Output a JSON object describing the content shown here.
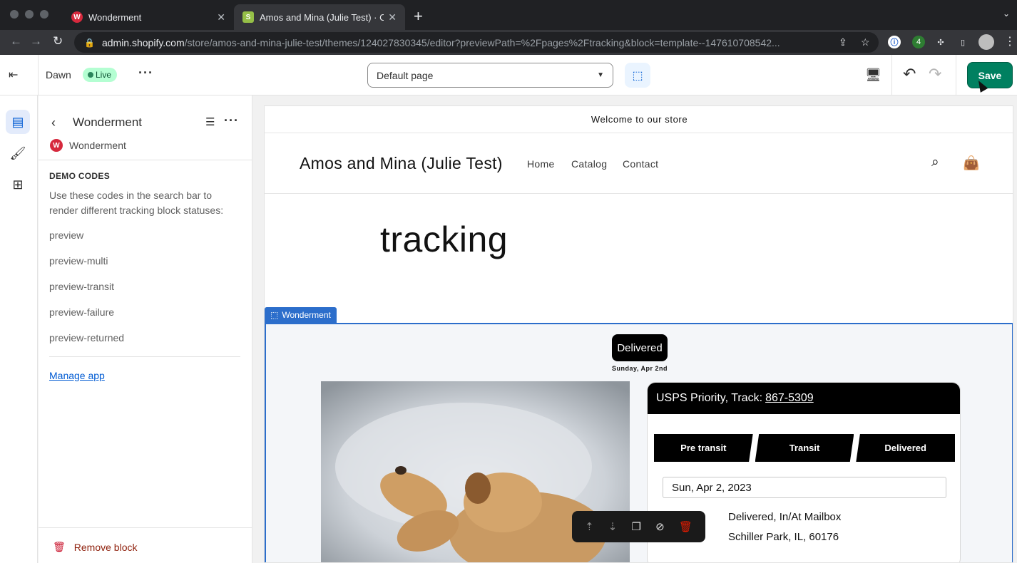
{
  "browser": {
    "tabs": [
      {
        "title": "Wonderment",
        "favicon": "W"
      },
      {
        "title": "Amos and Mina (Julie Test) · Customize",
        "favicon": "S"
      }
    ],
    "url_host": "admin.shopify.com",
    "url_path": "/store/amos-and-mina-julie-test/themes/124027830345/editor?previewPath=%2Fpages%2Ftracking&block=template--147610708542..."
  },
  "topbar": {
    "theme_name": "Dawn",
    "live_label": "Live",
    "page_select": "Default page",
    "save_label": "Save"
  },
  "sidebar": {
    "title": "Wonderment",
    "app_name": "Wonderment",
    "heading": "DEMO CODES",
    "description": "Use these codes in the search bar to render different tracking block statuses:",
    "codes": [
      "preview",
      "preview-multi",
      "preview-transit",
      "preview-failure",
      "preview-returned"
    ],
    "manage_link": "Manage app",
    "remove_label": "Remove block"
  },
  "store": {
    "announcement": "Welcome to our store",
    "name": "Amos and Mina (Julie Test)",
    "nav": [
      "Home",
      "Catalog",
      "Contact"
    ],
    "page_title": "tracking"
  },
  "block": {
    "tag": "Wonderment",
    "status": "Delivered",
    "status_date": "Sunday, Apr 2nd",
    "carrier_text": "USPS Priority, Track:",
    "tracking_number": "867-5309",
    "steps": [
      "Pre transit",
      "Transit",
      "Delivered"
    ],
    "event_date": "Sun, Apr 2, 2023",
    "event_status": "Delivered, In/At Mailbox",
    "event_location": "Schiller Park, IL, 60176"
  },
  "colors": {
    "save": "#008060",
    "selection": "#2c6ecb",
    "live_badge": "#b4fed2"
  }
}
